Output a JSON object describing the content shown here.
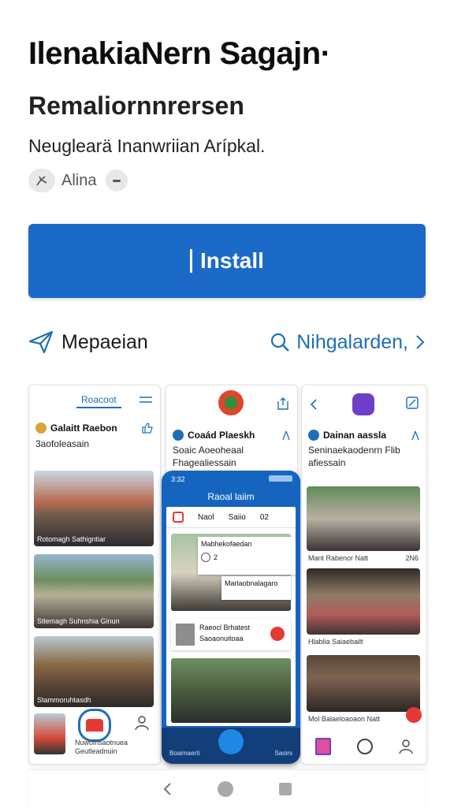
{
  "app": {
    "title": "IlenakiaNern Sagajn·",
    "subtitle": "Remaliornnrersen",
    "tagline": "Neuglearä Inanwriian Arípkal.",
    "rating_label": "Alina"
  },
  "install": {
    "label": "Install"
  },
  "links": {
    "left": "Mepaeian",
    "right": "Nihgalarden,"
  },
  "screenshots": {
    "s1": {
      "tab": "Roacoot",
      "card_title": "Galaitt Raebon",
      "card_sub": "3aofoleasain",
      "captions": [
        "Rotomagh Sathigntiar",
        "Stlemagh Suhnshia Ginun",
        "Stammoruhtasdh"
      ],
      "footer": [
        "Nuwolnsaotnuea",
        "Geutleadnuin"
      ]
    },
    "s2": {
      "card_title": "Coaád Plaeskh",
      "card_sub": "Soaic Aoeoheaal Fhagealiessain",
      "phone_time": "3:32",
      "phone_header": "Raoal laiim",
      "tabs": [
        "Naol",
        "Saiio",
        "02"
      ],
      "popup_title": "Mabhekofaedan",
      "popup_count": "2",
      "popup_text": "Marlaobnalagaro",
      "item_title": "Raeocl Brhatest",
      "item_sub": "Saoaonuitoaa",
      "bottom_left": "Boaimaerti",
      "bottom_right": "Saoirs"
    },
    "s3": {
      "card_title": "Dainan aassla",
      "card_sub": "Seninaekaodenrn Flib afiessain",
      "captions": [
        "Mant Rabenor Natt",
        "Hlablia Saiaebailt",
        "Mol Balaeloaoaon Natt"
      ],
      "caption_num": "2N6"
    }
  },
  "nav": {
    "back": "back",
    "home": "home",
    "recents": "recents"
  },
  "colors": {
    "accent": "#1c6ac8",
    "link": "#1e6fb8",
    "red": "#e53935",
    "purple": "#6f3fc8"
  },
  "icons": [
    "send-icon",
    "search-icon",
    "chevron-right-icon",
    "hand-icon",
    "menu-icon",
    "share-icon"
  ]
}
